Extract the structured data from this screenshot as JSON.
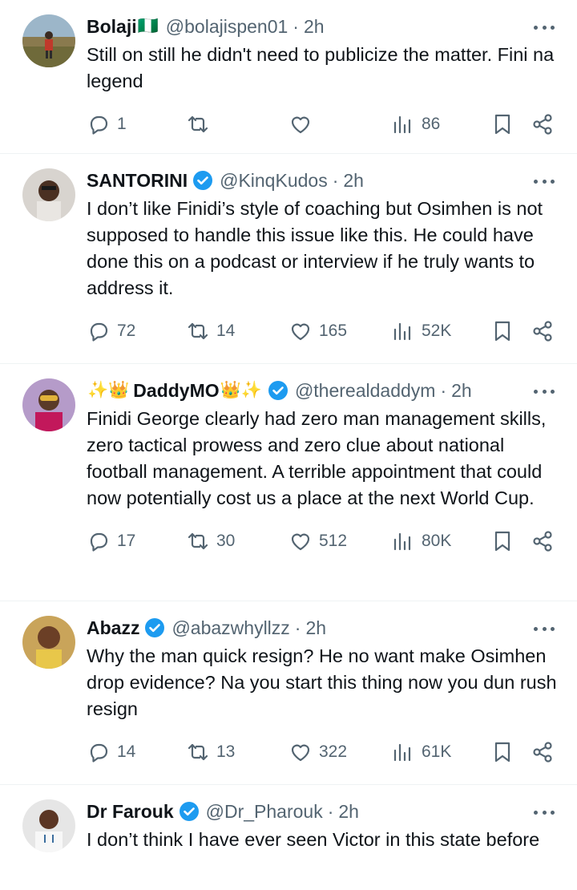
{
  "tweets": [
    {
      "name": "Bolaji",
      "flag": "🇳🇬",
      "verified": false,
      "handle": "@bolajispen01",
      "time": "2h",
      "text": "Still on still he didn't need to publicize the matter. Fini na legend",
      "replies": "1",
      "retweets": "",
      "likes": "",
      "views": "86"
    },
    {
      "name": "SANTORINI",
      "verified": true,
      "handle": "@KinqKudos",
      "time": "2h",
      "text": "I don’t like Finidi’s style of coaching but Osimhen is not supposed to handle this issue like this. He could have done this on a podcast or interview if he truly wants to address it.",
      "replies": "72",
      "retweets": "14",
      "likes": "165",
      "views": "52K"
    },
    {
      "name_prefix": "✨👑",
      "name": "DaddyMO",
      "name_suffix": "👑✨",
      "verified": true,
      "handle": "@therealdaddym",
      "time": "2h",
      "text": "Finidi George clearly had zero man management skills, zero tactical prowess and zero clue about national football management. A terrible appointment that could now potentially cost us a place at the next World Cup.",
      "replies": "17",
      "retweets": "30",
      "likes": "512",
      "views": "80K"
    },
    {
      "name": "Abazz",
      "verified": true,
      "handle": "@abazwhyllzz",
      "time": "2h",
      "text": "Why the man quick resign? He no want make Osimhen drop evidence? Na you start this thing now you dun rush resign",
      "replies": "14",
      "retweets": "13",
      "likes": "322",
      "views": "61K"
    },
    {
      "name": "Dr Farouk",
      "verified": true,
      "handle": "@Dr_Pharouk",
      "time": "2h",
      "text": "I don’t think I have ever seen Victor in this state before"
    }
  ],
  "separator": "·",
  "colors": {
    "text": "#0f1419",
    "muted": "#536471",
    "verified": "#1d9bf0",
    "divider": "#eff3f4"
  },
  "icons": [
    "reply-icon",
    "retweet-icon",
    "like-icon",
    "views-icon",
    "bookmark-icon",
    "share-icon",
    "more-icon",
    "verified-badge-icon"
  ]
}
